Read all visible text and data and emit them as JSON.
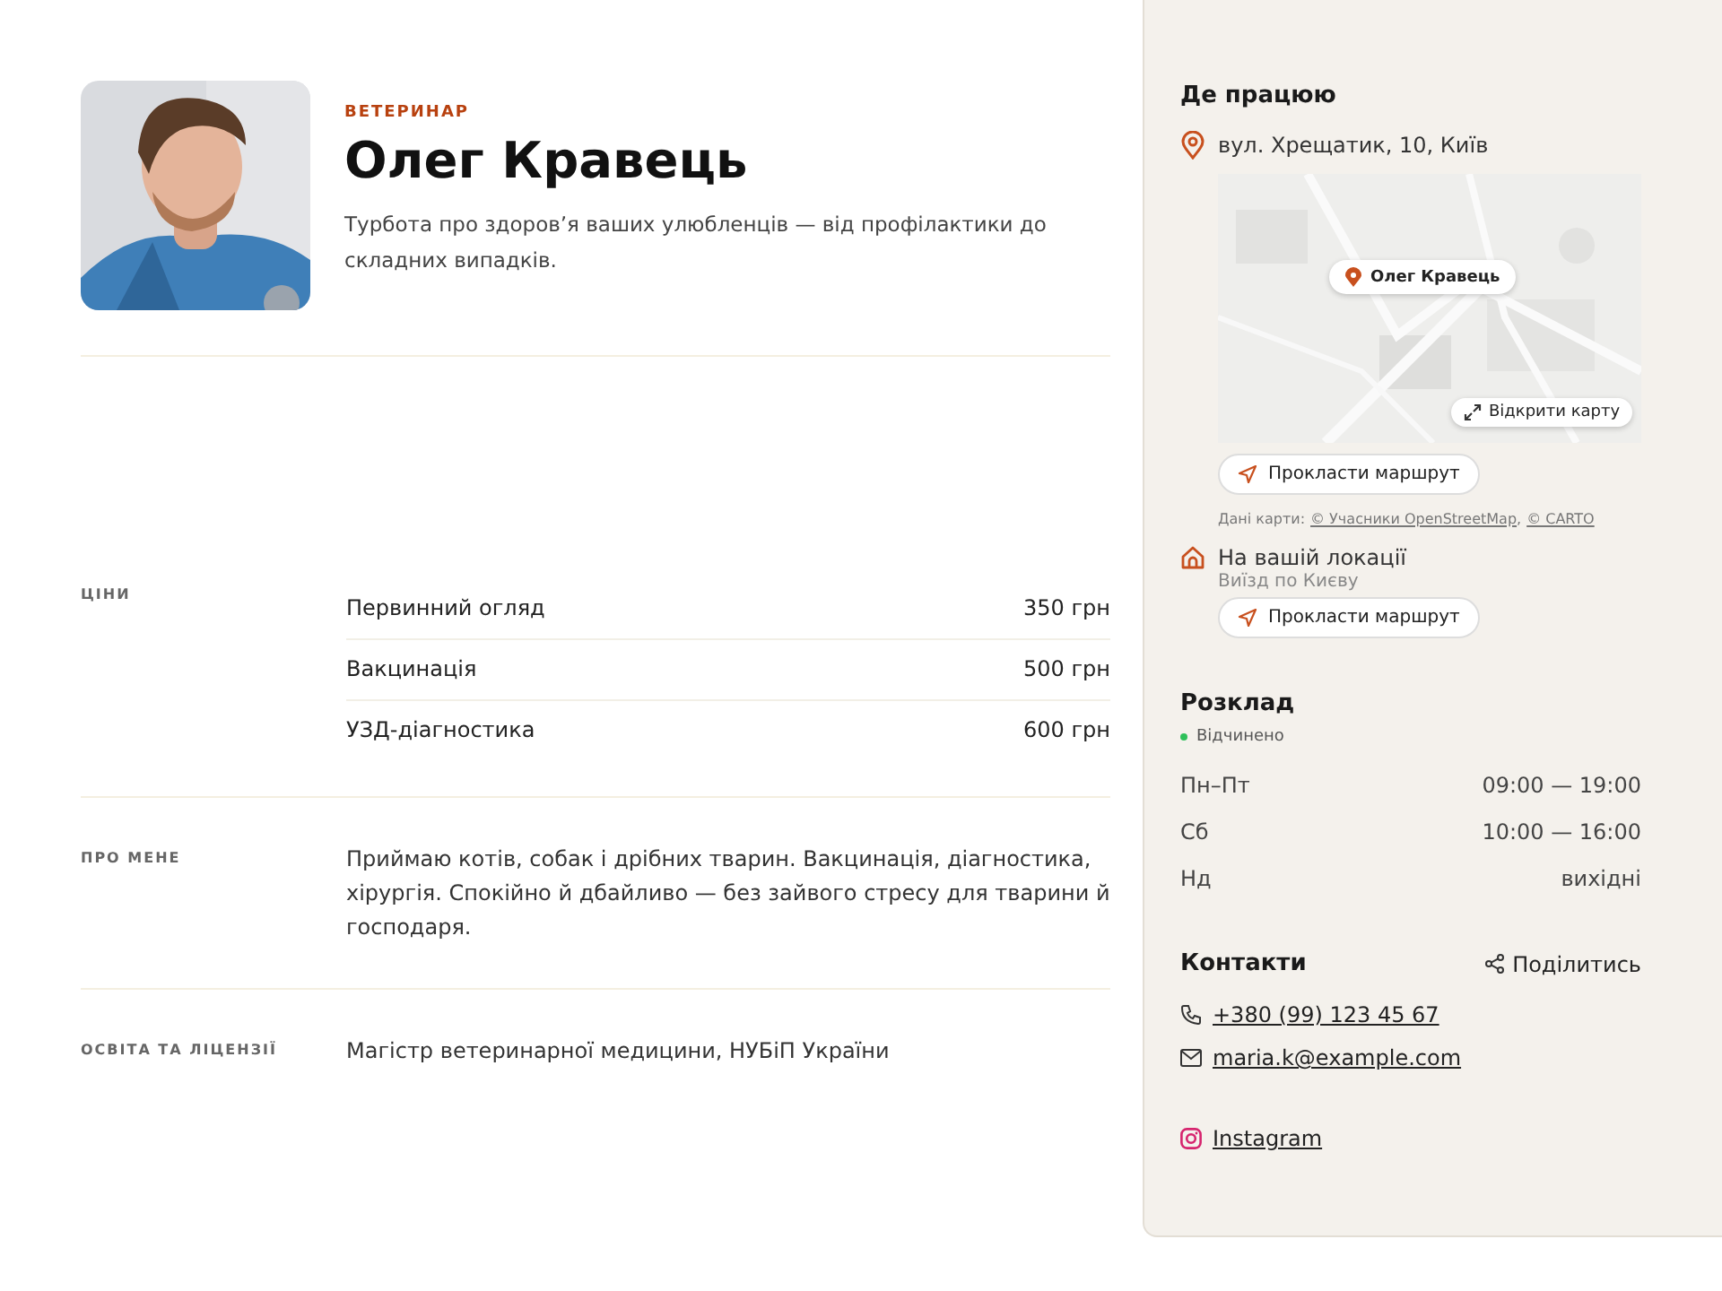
{
  "profile": {
    "role": "ВЕТЕРИНАР",
    "name": "Олег Кравець",
    "tagline": "Турбота про здоров’я ваших улюбленців — від профілактики до складних випадків."
  },
  "sections": [
    {
      "kind": "prices",
      "label": "ЦІНИ",
      "items": [
        {
          "name": "Первинний огляд",
          "price": "350 грн"
        },
        {
          "name": "Вакцинація",
          "price": "500 грн"
        },
        {
          "name": "УЗД-діагностика",
          "price": "600 грн"
        }
      ]
    },
    {
      "kind": "text",
      "label": "ПРО МЕНЕ",
      "text": "Приймаю котів, собак і дрібних тварин. Вакцинація, діагностика, хірургія. Спокійно й дбайливо — без зайвого стресу для тварини й господаря."
    },
    {
      "kind": "text",
      "label": "ОСВІТА ТА ЛІЦЕНЗІЇ",
      "text": "Магістр ветеринарної медицини, НУБіП України"
    }
  ],
  "sidebar": {
    "where": {
      "title": "Де працюю",
      "address": "вул. Хрещатик, 10, Київ",
      "map": {
        "pin_label": "Олег Кравець",
        "open_button": "Відкрити карту"
      },
      "route_button": "Прокласти маршрут",
      "attribution": "Дані карти:",
      "attribution_separator": ",",
      "attribution_links": [
        "© Учасники OpenStreetMap",
        "© CARTO"
      ],
      "mobile": {
        "title": "На вашій локації",
        "subtitle": "Виїзд по Києву",
        "route_button": "Прокласти маршрут"
      }
    },
    "schedule": {
      "title": "Розклад",
      "status": {
        "label": "Відчинено",
        "open": true
      },
      "rows": [
        {
          "day": "Пн–Пт",
          "hours": "09:00 — 19:00"
        },
        {
          "day": "Сб",
          "hours": "10:00 — 16:00"
        },
        {
          "day": "Нд",
          "hours": "вихідні"
        }
      ]
    },
    "contacts": {
      "title": "Контакти",
      "share": "Поділитись",
      "items": [
        {
          "kind": "phone",
          "text": "+380 (99) 123 45 67"
        },
        {
          "kind": "email",
          "text": "maria.k@example.com"
        },
        {
          "kind": "instagram",
          "text": "Instagram"
        }
      ]
    }
  }
}
